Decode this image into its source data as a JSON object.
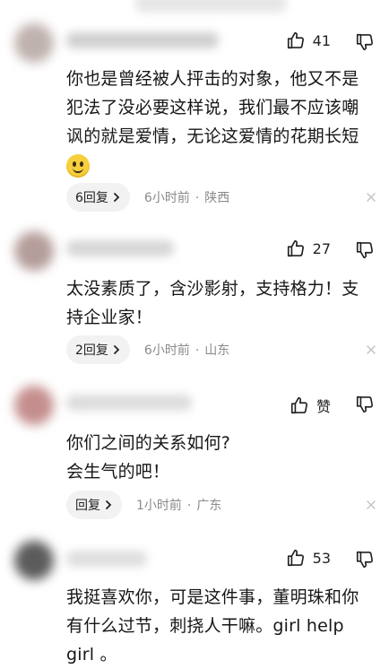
{
  "comments": [
    {
      "likes": "41",
      "text": "你也是曾经被人抨击的对象，他又不是犯法了没必要这样说，我们最不应该嘲讽的就是爱情，无论这爱情的花期长短",
      "emoji": "smile-emoji",
      "reply_label": "6回复",
      "time": "6小时前",
      "location": "陕西",
      "avatar_color": "#bfb2ae"
    },
    {
      "likes": "27",
      "text": "太没素质了，含沙影射，支持格力！支持企业家！",
      "reply_label": "2回复",
      "time": "6小时前",
      "location": "山东",
      "avatar_color": "#b49d9a"
    },
    {
      "likes": "赞",
      "text_lines": [
        "你们之间的关系如何?",
        "会生气的吧！"
      ],
      "reply_label": "回复",
      "time": "1小时前",
      "location": "广东",
      "avatar_color": "#c58e8e"
    },
    {
      "likes": "53",
      "text": "我挺喜欢你，可是这件事，董明珠和你有什么过节，刺挠人干嘛。girl help girl 。",
      "avatar_color": "#5b5b5b"
    }
  ],
  "icons": {
    "like": "thumbs-up-icon",
    "dislike": "thumbs-down-icon",
    "close": "close-icon",
    "chevron": "chevron-right-icon"
  }
}
